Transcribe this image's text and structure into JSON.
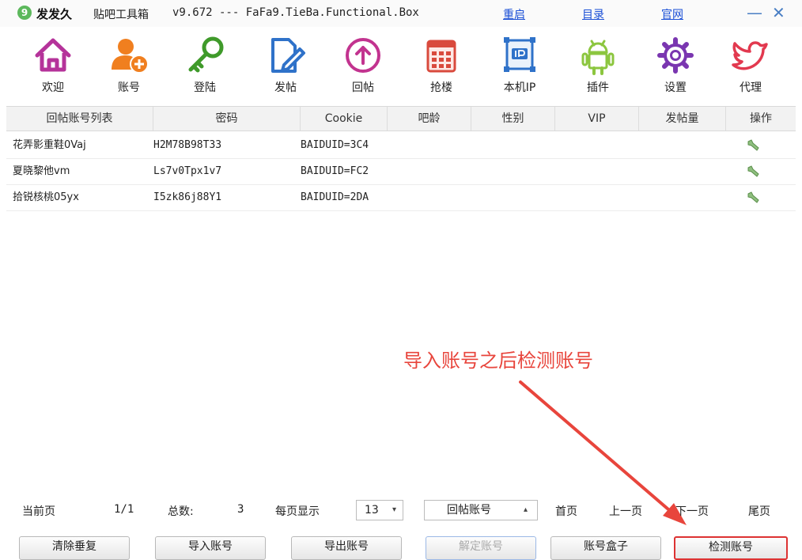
{
  "titlebar": {
    "app_logo": "9",
    "app_name": "发发久",
    "app_subtitle": "贴吧工具箱",
    "app_version": "v9.672 --- FaFa9.TieBa.Functional.Box",
    "links": [
      "重启",
      "目录",
      "官网"
    ],
    "minimize": "—",
    "close": "✕"
  },
  "toolbar": {
    "items": [
      {
        "label": "欢迎",
        "icon": "home-icon",
        "color": "#b5339a"
      },
      {
        "label": "账号",
        "icon": "account-add-icon",
        "color": "#f07f1f"
      },
      {
        "label": "登陆",
        "icon": "key-icon",
        "color": "#3f9a2a"
      },
      {
        "label": "发帖",
        "icon": "edit-doc-icon",
        "color": "#2f72c9"
      },
      {
        "label": "回帖",
        "icon": "upload-circle-icon",
        "color": "#c2338f"
      },
      {
        "label": "抢楼",
        "icon": "calendar-building-icon",
        "color": "#d94a3d"
      },
      {
        "label": "本机IP",
        "icon": "ip-icon",
        "color": "#2f72c9"
      },
      {
        "label": "插件",
        "icon": "android-icon",
        "color": "#8cc63f"
      },
      {
        "label": "设置",
        "icon": "gear-icon",
        "color": "#7a36b0"
      },
      {
        "label": "代理",
        "icon": "bird-icon",
        "color": "#e2394f"
      }
    ]
  },
  "table": {
    "headers": [
      "回帖账号列表",
      "密码",
      "Cookie",
      "吧龄",
      "性别",
      "VIP",
      "发帖量",
      "操作"
    ],
    "rows": [
      {
        "account": "花弄影重鞋0Vaj",
        "password": "H2M78B98T33",
        "cookie": "BAIDUID=3C4"
      },
      {
        "account": "夏晓黎他vm",
        "password": "Ls7v0Tpx1v7",
        "cookie": "BAIDUID=FC2"
      },
      {
        "account": "拾锐核桃05yx",
        "password": "I5zk86j88Y1",
        "cookie": "BAIDUID=2DA"
      }
    ],
    "op_icon": "wrench-icon"
  },
  "annotation": {
    "text": "导入账号之后检测账号",
    "color": "#e8453c"
  },
  "statusbar": {
    "current_page_label": "当前页",
    "current_page_value": "1/1",
    "total_label": "总数:",
    "total_value": "3",
    "per_page_label": "每页显示",
    "per_page_value": "13",
    "account_type_value": "回帖账号",
    "first": "首页",
    "prev": "上一页",
    "next": "下一页",
    "last": "尾页"
  },
  "buttons": {
    "clear": "清除垂复",
    "import": "导入账号",
    "export": "导出账号",
    "disabled": "解定账号",
    "box": "账号盒子",
    "detect": "检测账号"
  }
}
